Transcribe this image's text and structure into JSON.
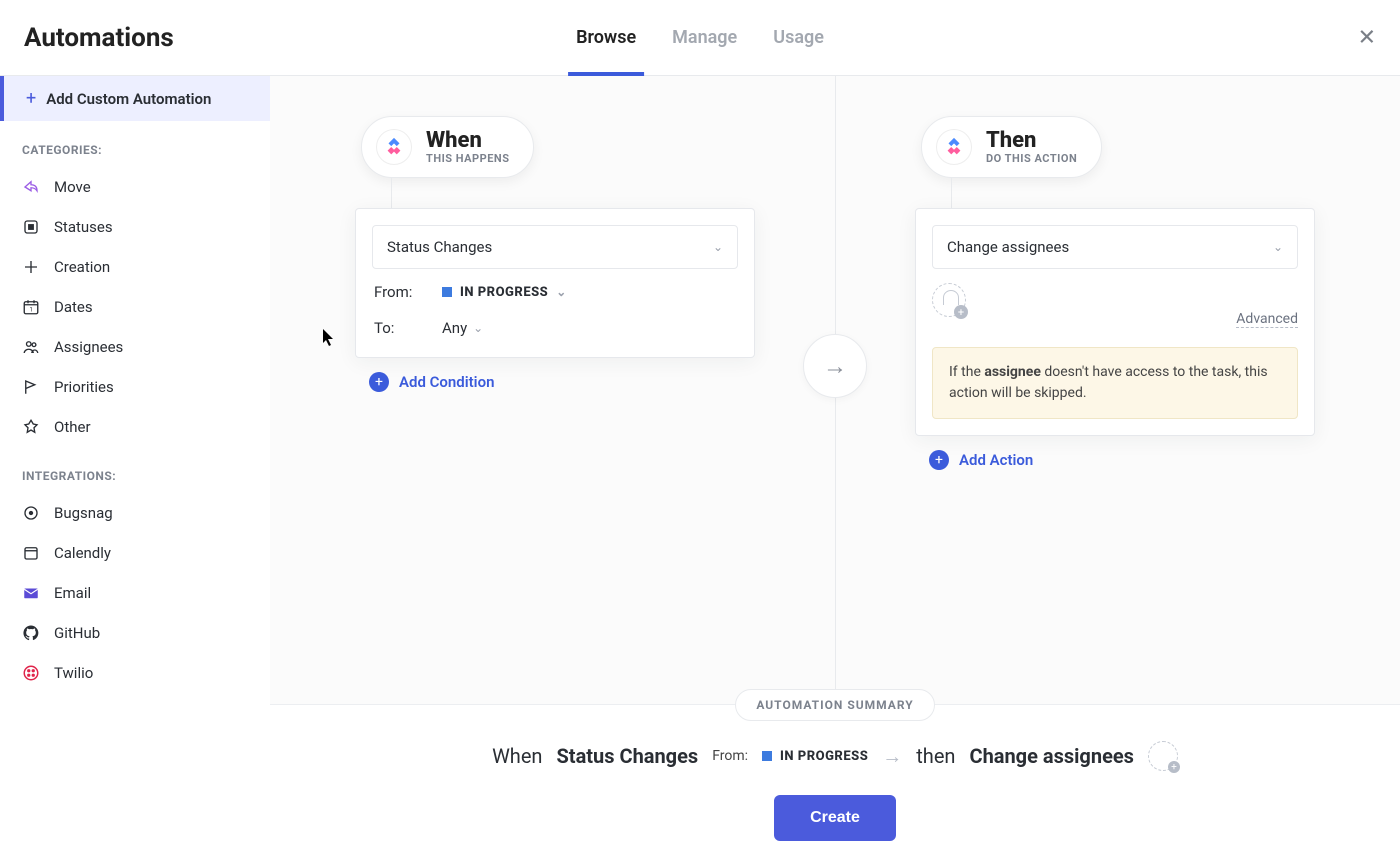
{
  "header": {
    "title": "Automations",
    "tabs": {
      "browse": "Browse",
      "manage": "Manage",
      "usage": "Usage"
    }
  },
  "sidebar": {
    "add_custom": "Add Custom Automation",
    "categories_label": "CATEGORIES:",
    "categories": {
      "move": "Move",
      "statuses": "Statuses",
      "creation": "Creation",
      "dates": "Dates",
      "assignees": "Assignees",
      "priorities": "Priorities",
      "other": "Other"
    },
    "integrations_label": "INTEGRATIONS:",
    "integrations": {
      "bugsnag": "Bugsnag",
      "calendly": "Calendly",
      "email": "Email",
      "github": "GitHub",
      "twilio": "Twilio"
    }
  },
  "builder": {
    "when": {
      "title": "When",
      "subtitle": "THIS HAPPENS",
      "trigger": "Status Changes",
      "from_label": "From:",
      "from_value": "IN PROGRESS",
      "to_label": "To:",
      "to_value": "Any",
      "add_condition": "Add Condition"
    },
    "then": {
      "title": "Then",
      "subtitle": "DO THIS ACTION",
      "action": "Change assignees",
      "advanced": "Advanced",
      "warning_prefix": "If the ",
      "warning_bold": "assignee",
      "warning_suffix": " doesn't have access to the task, this action will be skipped.",
      "add_action": "Add Action"
    }
  },
  "footer": {
    "summary_label": "AUTOMATION SUMMARY",
    "when_word": "When",
    "trigger": "Status Changes",
    "from_label": "From:",
    "from_value": "IN PROGRESS",
    "then_word": "then",
    "action": "Change assignees",
    "create_button": "Create"
  }
}
